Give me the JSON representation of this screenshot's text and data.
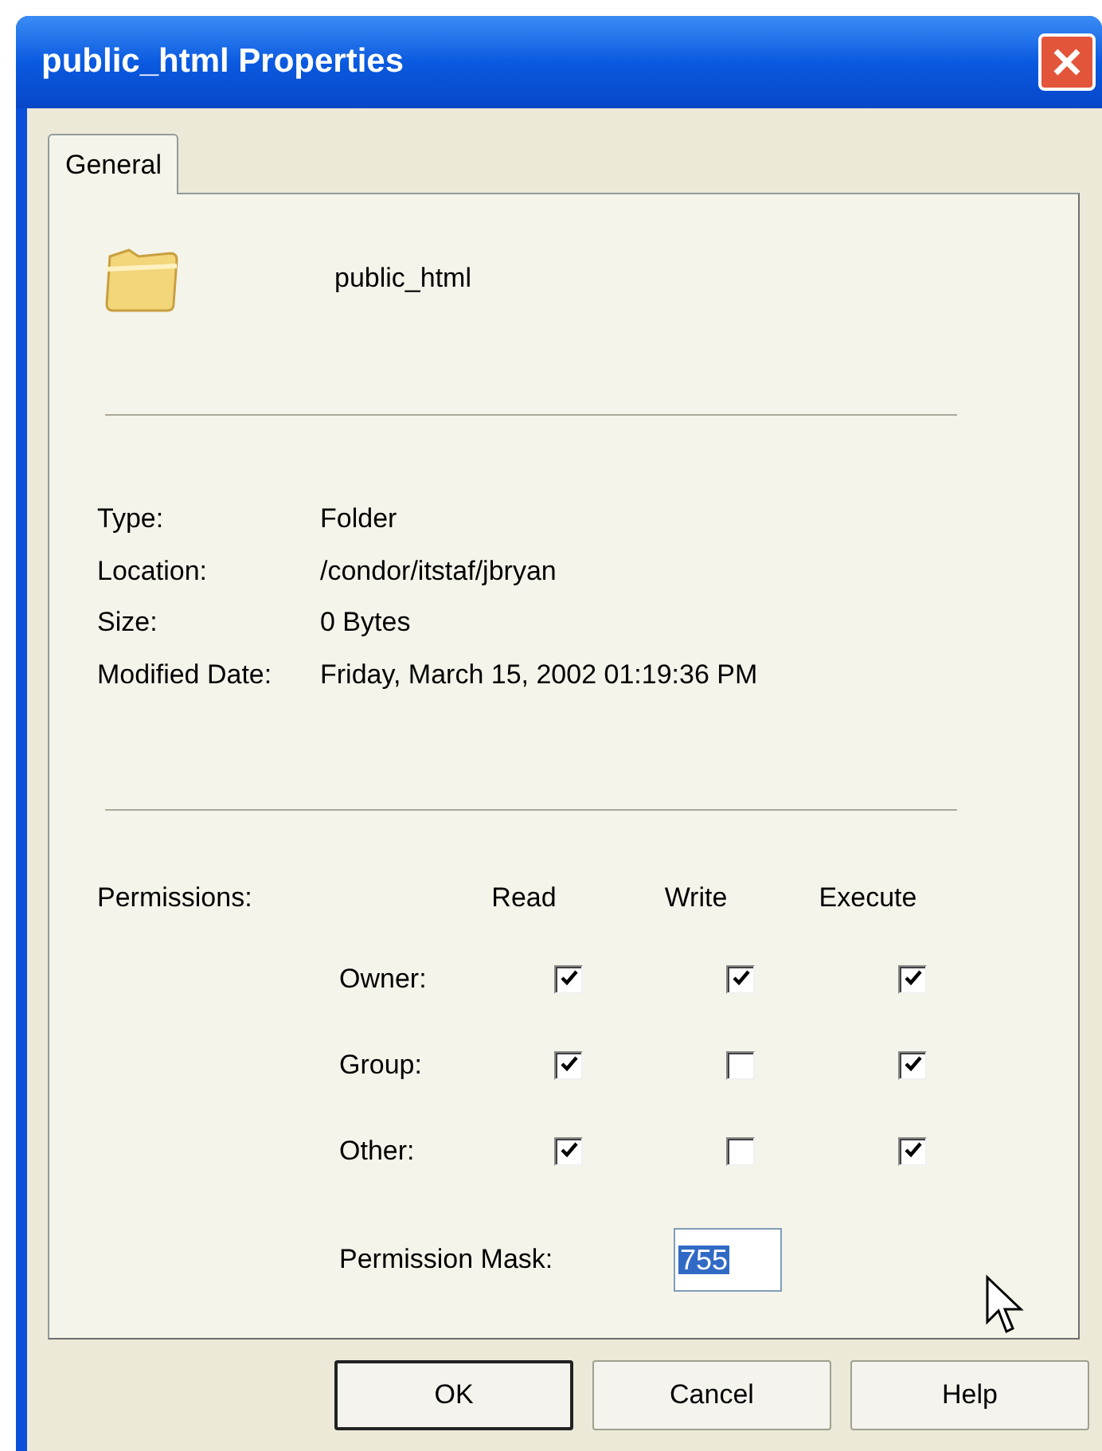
{
  "window": {
    "title": "public_html Properties"
  },
  "tabs": [
    {
      "label": "General",
      "selected": true
    }
  ],
  "item": {
    "name": "public_html"
  },
  "info": [
    {
      "label": "Type:",
      "value": "Folder"
    },
    {
      "label": "Location:",
      "value": "/condor/itstaf/jbryan"
    },
    {
      "label": "Size:",
      "value": "0 Bytes"
    },
    {
      "label": "Modified Date:",
      "value": "Friday, March 15, 2002 01:19:36 PM"
    }
  ],
  "permissions": {
    "label": "Permissions:",
    "columns": [
      "Read",
      "Write",
      "Execute"
    ],
    "rows": [
      {
        "label": "Owner:",
        "checks": [
          {
            "checked": true
          },
          {
            "checked": true
          },
          {
            "checked": true
          }
        ]
      },
      {
        "label": "Group:",
        "checks": [
          {
            "checked": true
          },
          {
            "checked": false
          },
          {
            "checked": true
          }
        ]
      },
      {
        "label": "Other:",
        "checks": [
          {
            "checked": true
          },
          {
            "checked": false
          },
          {
            "checked": true
          }
        ]
      }
    ],
    "mask_label": "Permission Mask:",
    "mask_value": "755"
  },
  "buttons": [
    {
      "label": "OK",
      "default": true
    },
    {
      "label": "Cancel",
      "default": false
    },
    {
      "label": "Help",
      "default": false
    }
  ]
}
